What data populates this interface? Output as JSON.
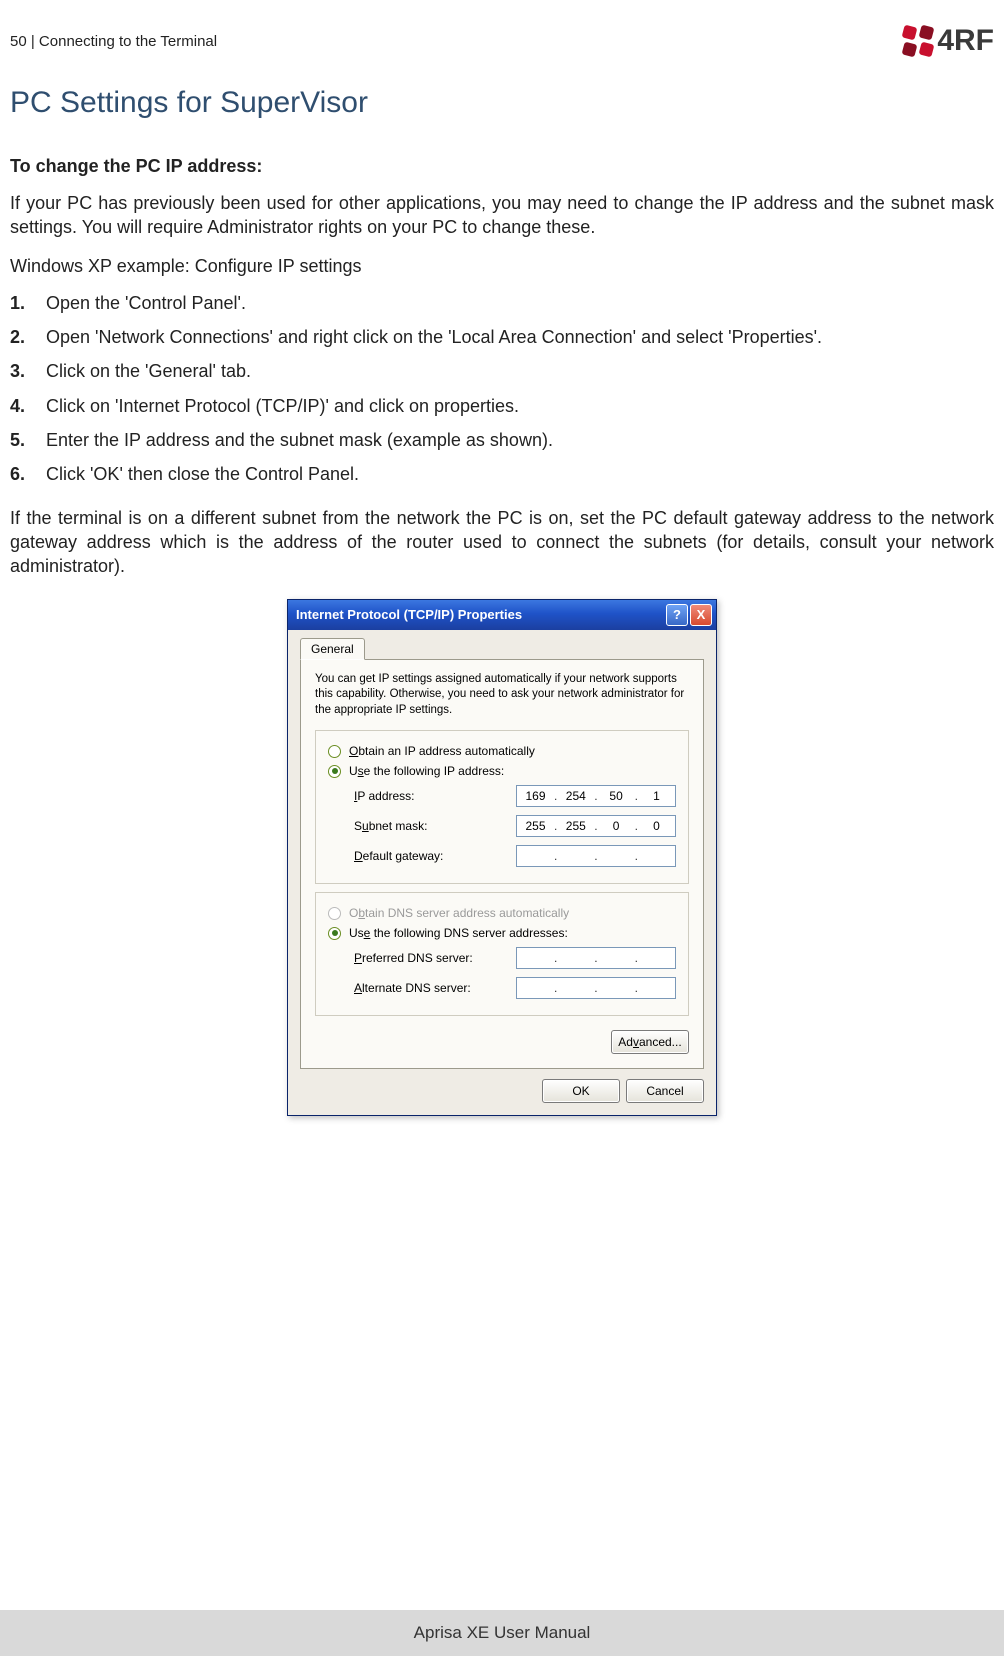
{
  "header": {
    "page_number": "50",
    "separator": "  |  ",
    "section": "Connecting to the Terminal",
    "logo_text": "4RF"
  },
  "title": "PC Settings for SuperVisor",
  "lead": "To change the PC IP address:",
  "para1": "If your PC has previously been used for other applications, you may need to change the IP address and the subnet mask settings. You will require Administrator rights on your PC to change these.",
  "para2": "Windows XP example: Configure IP settings",
  "steps": [
    "Open the 'Control Panel'.",
    "Open 'Network Connections' and right click on the 'Local Area Connection' and select 'Properties'.",
    "Click on the 'General' tab.",
    "Click on 'Internet Protocol (TCP/IP)' and click on properties.",
    "Enter the IP address and the subnet mask (example as shown).",
    "Click 'OK' then close the Control Panel."
  ],
  "para3": "If the terminal is on a different subnet from the network the PC is on, set the PC default gateway address to the network gateway address which is the address of the router used to connect the subnets (for details, consult your network administrator).",
  "dialog": {
    "title": "Internet Protocol (TCP/IP) Properties",
    "help_btn": "?",
    "close_btn": "X",
    "tab": "General",
    "note": "You can get IP settings assigned automatically if your network supports this capability. Otherwise, you need to ask your network administrator for the appropriate IP settings.",
    "radio_auto_ip": "Obtain an IP address automatically",
    "radio_use_ip": "Use the following IP address:",
    "ip_label": "IP address:",
    "ip_value": [
      "169",
      "254",
      "50",
      "1"
    ],
    "subnet_label": "Subnet mask:",
    "subnet_value": [
      "255",
      "255",
      "0",
      "0"
    ],
    "gateway_label": "Default gateway:",
    "gateway_value": [
      "",
      "",
      "",
      ""
    ],
    "radio_auto_dns": "Obtain DNS server address automatically",
    "radio_use_dns": "Use the following DNS server addresses:",
    "pref_dns_label": "Preferred DNS server:",
    "pref_dns_value": [
      "",
      "",
      "",
      ""
    ],
    "alt_dns_label": "Alternate DNS server:",
    "alt_dns_value": [
      "",
      "",
      "",
      ""
    ],
    "advanced_btn": "Advanced...",
    "ok_btn": "OK",
    "cancel_btn": "Cancel"
  },
  "footer": "Aprisa XE User Manual"
}
